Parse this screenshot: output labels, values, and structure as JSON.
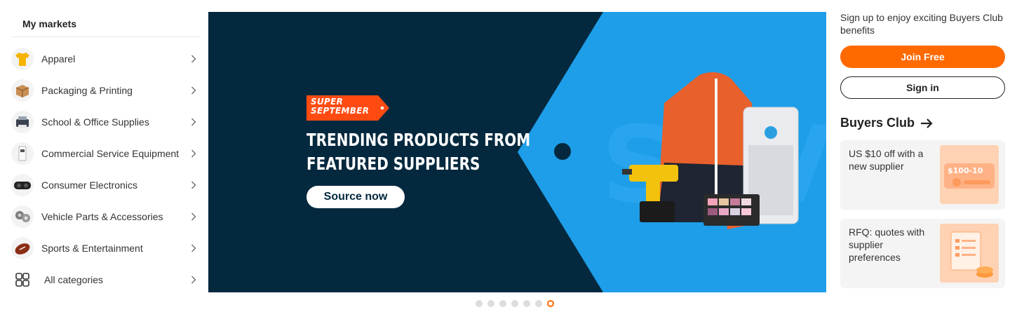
{
  "sidebar": {
    "title": "My markets",
    "items": [
      {
        "label": "Apparel",
        "icon": "tshirt-icon"
      },
      {
        "label": "Packaging & Printing",
        "icon": "box-icon"
      },
      {
        "label": "School & Office Supplies",
        "icon": "printer-icon"
      },
      {
        "label": "Commercial Service Equipment",
        "icon": "dispenser-icon"
      },
      {
        "label": "Consumer Electronics",
        "icon": "vr-headset-icon"
      },
      {
        "label": "Vehicle Parts & Accessories",
        "icon": "engine-parts-icon"
      },
      {
        "label": "Sports & Entertainment",
        "icon": "football-icon"
      }
    ],
    "all_categories": "All categories"
  },
  "banner": {
    "badge_line1": "SUPER",
    "badge_line2": "SEPTEMBER",
    "headline_line1": "TRENDING PRODUCTS FROM",
    "headline_line2": "FEATURED SUPPLIERS",
    "cta": "Source now",
    "slide_count": 7,
    "active_slide": 7
  },
  "right": {
    "signup_text": "Sign up to enjoy exciting Buyers Club benefits",
    "join_label": "Join Free",
    "signin_label": "Sign in",
    "club_title": "Buyers Club",
    "cards": [
      {
        "text": "US $10 off with a new supplier",
        "image_text": "$100-10"
      },
      {
        "text": "RFQ: quotes with supplier preferences"
      }
    ]
  },
  "colors": {
    "accent": "#ff6a00",
    "banner_dark": "#04293f",
    "banner_blue": "#1e9ee8"
  }
}
